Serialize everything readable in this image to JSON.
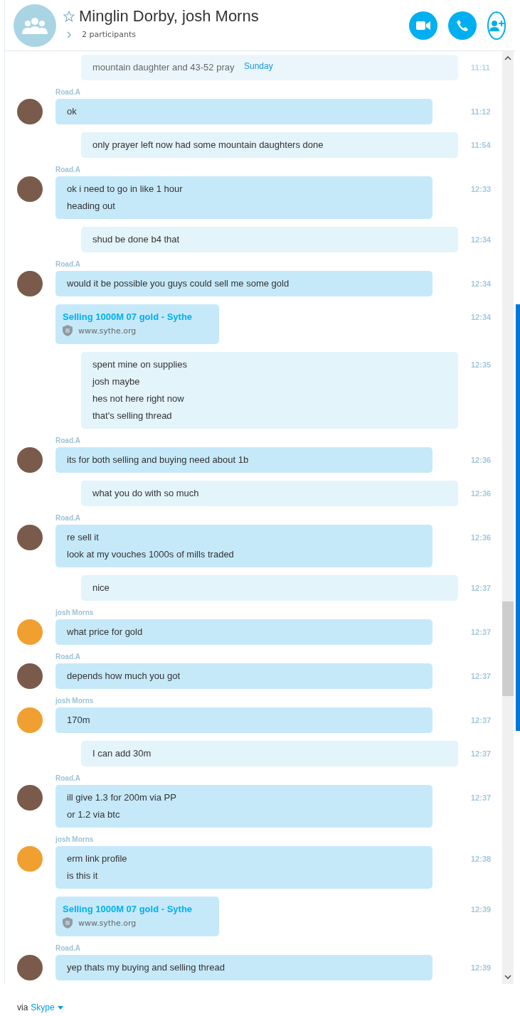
{
  "header": {
    "title": "Minglin Dorby, josh Morns",
    "participants": "2 participants"
  },
  "date_label": "Sunday",
  "messages": [
    {
      "kind": "outgoing",
      "faded": true,
      "lines": [
        "mountain daughter and 43-52 pray"
      ],
      "time": "11:11"
    },
    {
      "kind": "incoming",
      "faded": false,
      "sender": "Road.A",
      "color": "#7a5a4a",
      "lines": [
        "ok"
      ],
      "time": "11:12"
    },
    {
      "kind": "outgoing",
      "faded": false,
      "lines": [
        "only prayer left now had some mountain daughters done"
      ],
      "time": "11:54"
    },
    {
      "kind": "incoming",
      "faded": false,
      "sender": "Road.A",
      "color": "#7a5a4a",
      "lines": [
        "ok i need to go in like 1 hour",
        "heading out"
      ],
      "time": "12:33"
    },
    {
      "kind": "outgoing",
      "faded": false,
      "lines": [
        "shud be done b4 that"
      ],
      "time": "12:34"
    },
    {
      "kind": "incoming",
      "faded": false,
      "sender": "Road.A",
      "color": "#7a5a4a",
      "lines": [
        "would it be possible you guys could sell me some gold"
      ],
      "time": "12:34"
    },
    {
      "kind": "link",
      "faded": false,
      "title": "Selling 1000M 07 gold - Sythe",
      "url": "www.sythe.org",
      "time": "12:34"
    },
    {
      "kind": "outgoing",
      "faded": false,
      "lines": [
        "spent mine on supplies",
        "josh maybe",
        "hes not here right now",
        "that's selling thread"
      ],
      "time": "12:35"
    },
    {
      "kind": "incoming",
      "faded": false,
      "sender": "Road.A",
      "color": "#7a5a4a",
      "lines": [
        "its for both selling and buying need about 1b"
      ],
      "time": "12:36"
    },
    {
      "kind": "outgoing",
      "faded": false,
      "lines": [
        "what you do with so much"
      ],
      "time": "12:36"
    },
    {
      "kind": "incoming",
      "faded": false,
      "sender": "Road.A",
      "color": "#7a5a4a",
      "lines": [
        "re sell it",
        "look at my vouches 1000s of mills traded"
      ],
      "time": "12:36"
    },
    {
      "kind": "outgoing",
      "faded": false,
      "lines": [
        "nice"
      ],
      "time": "12:37"
    },
    {
      "kind": "incoming",
      "faded": false,
      "sender": "josh Morns",
      "color": "#f0a030",
      "lines": [
        "what price for gold"
      ],
      "time": "12:37"
    },
    {
      "kind": "incoming",
      "faded": false,
      "sender": "Road.A",
      "color": "#7a5a4a",
      "lines": [
        "depends how much you got"
      ],
      "time": "12:37"
    },
    {
      "kind": "incoming",
      "faded": false,
      "sender": "josh Morns",
      "color": "#f0a030",
      "lines": [
        "170m"
      ],
      "time": "12:37"
    },
    {
      "kind": "outgoing",
      "faded": false,
      "lines": [
        "I can add 30m"
      ],
      "time": "12:37"
    },
    {
      "kind": "incoming",
      "faded": false,
      "sender": "Road.A",
      "color": "#7a5a4a",
      "lines": [
        "ill give 1.3 for 200m via PP",
        "or 1.2 via btc"
      ],
      "time": "12:37"
    },
    {
      "kind": "incoming",
      "faded": false,
      "sender": "josh Morns",
      "color": "#f0a030",
      "lines": [
        "erm link profile",
        "is this it"
      ],
      "time": "12:38"
    },
    {
      "kind": "link",
      "faded": false,
      "title": "Selling 1000M 07 gold - Sythe",
      "url": "www.sythe.org",
      "time": "12:39"
    },
    {
      "kind": "incoming",
      "faded": false,
      "sender": "Road.A",
      "color": "#7a5a4a",
      "lines": [
        "yep thats my buying and selling thread"
      ],
      "time": "12:39"
    }
  ],
  "footer": {
    "prefix": "via",
    "service": "Skype"
  }
}
